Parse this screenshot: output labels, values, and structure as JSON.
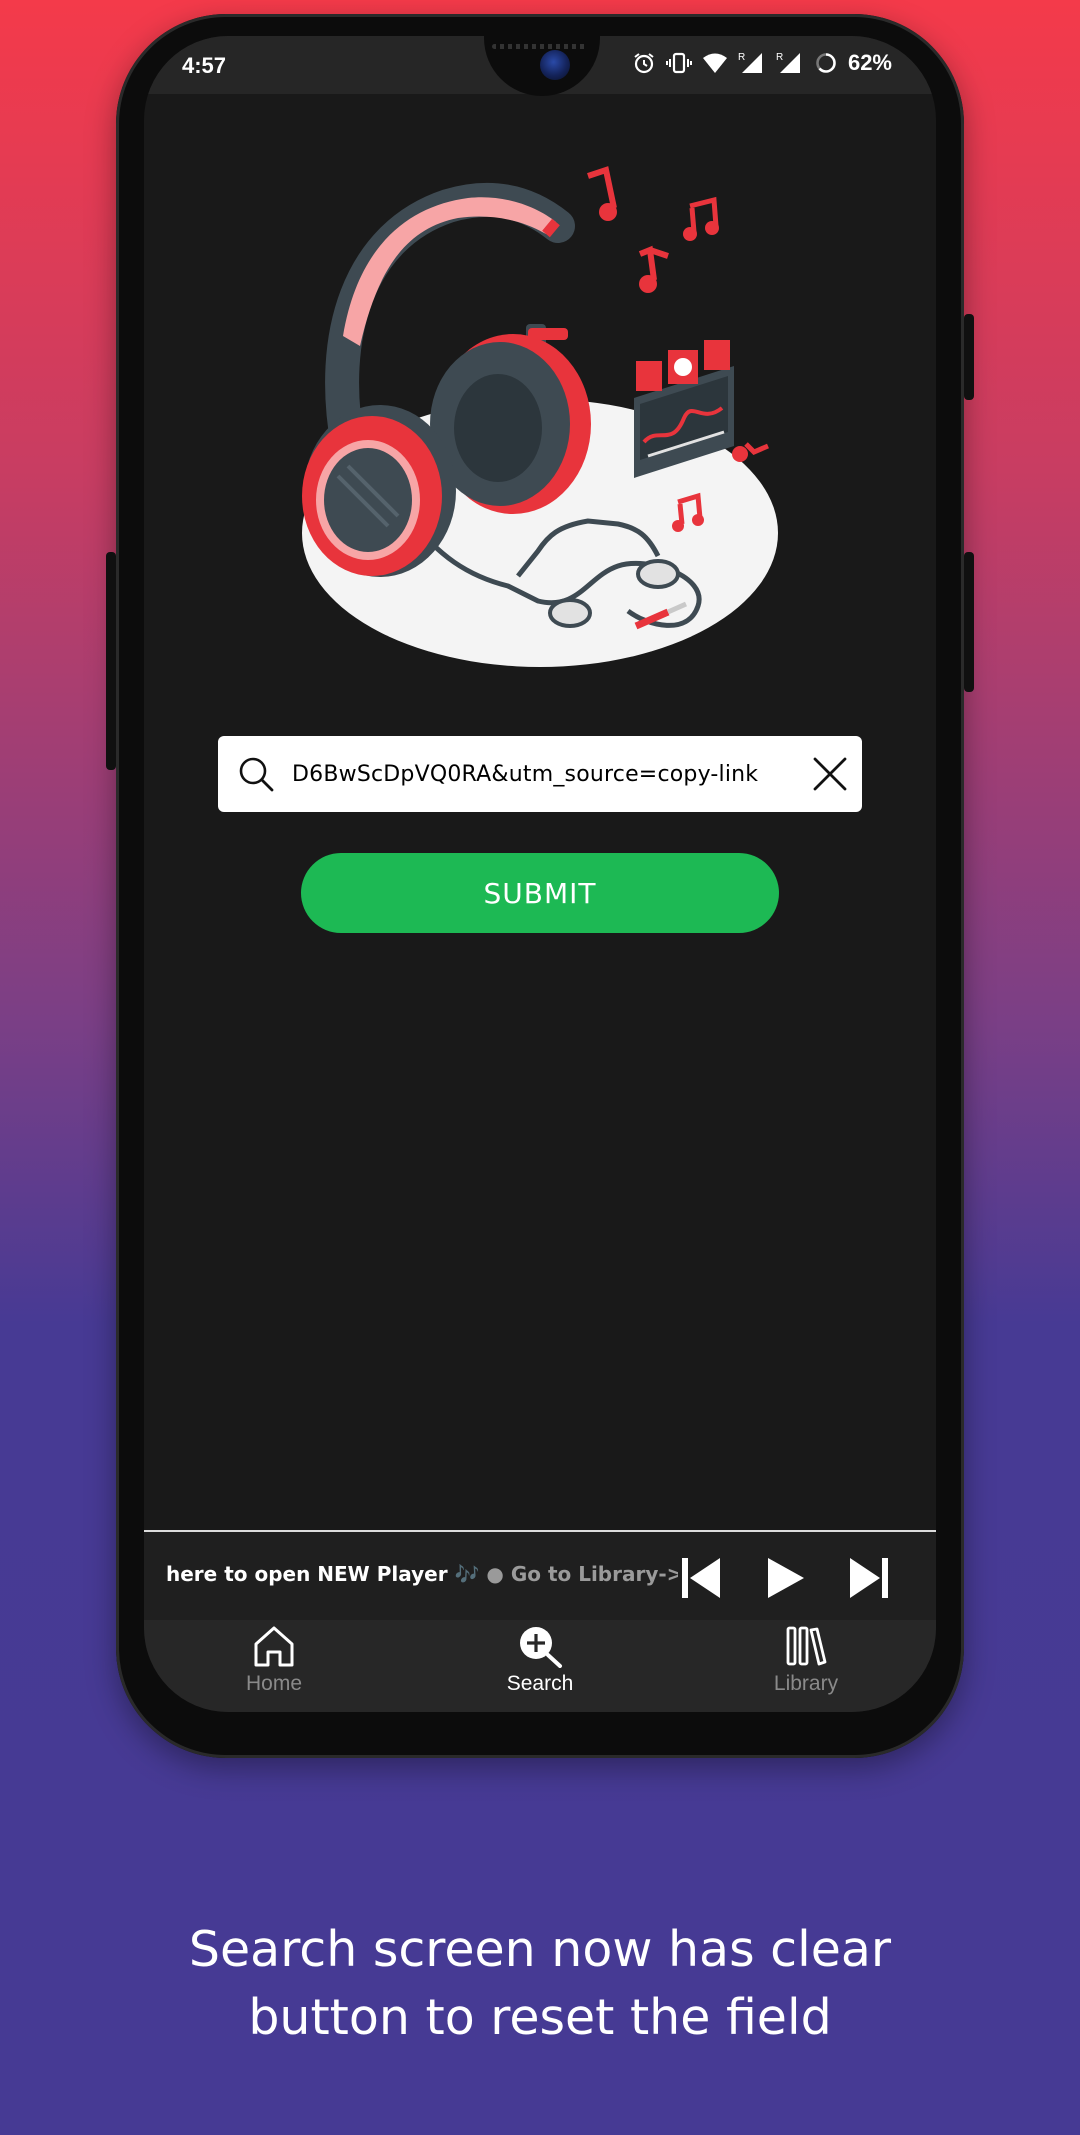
{
  "status_bar": {
    "time": "4:57",
    "battery": "62%",
    "icons": [
      "alarm-icon",
      "vibrate-icon",
      "wifi-icon",
      "signal-r-icon",
      "signal-r-icon",
      "battery-ring-icon"
    ]
  },
  "search": {
    "value": "D6BwScDpVQ0RA&utm_source=copy-link",
    "icon": "search-icon",
    "clear_icon": "close-icon"
  },
  "submit": {
    "label": "SUBMIT"
  },
  "player": {
    "marquee_primary": "here to open NEW Player 🎶",
    "marquee_secondary": "● Go to Library-> ● Dow",
    "controls": [
      "skip-previous-icon",
      "play-icon",
      "skip-next-icon"
    ]
  },
  "nav": {
    "items": [
      {
        "label": "Home",
        "icon": "home-icon",
        "active": false
      },
      {
        "label": "Search",
        "icon": "search-plus-icon",
        "active": true
      },
      {
        "label": "Library",
        "icon": "library-icon",
        "active": false
      }
    ]
  },
  "caption": {
    "line1": "Search screen now has clear",
    "line2": "button to reset the field"
  },
  "colors": {
    "accent_green": "#1db954",
    "illustration_red": "#e8343c",
    "screen_bg": "#191919",
    "gradient_top": "#f43a4a",
    "gradient_bottom": "#463a94"
  }
}
